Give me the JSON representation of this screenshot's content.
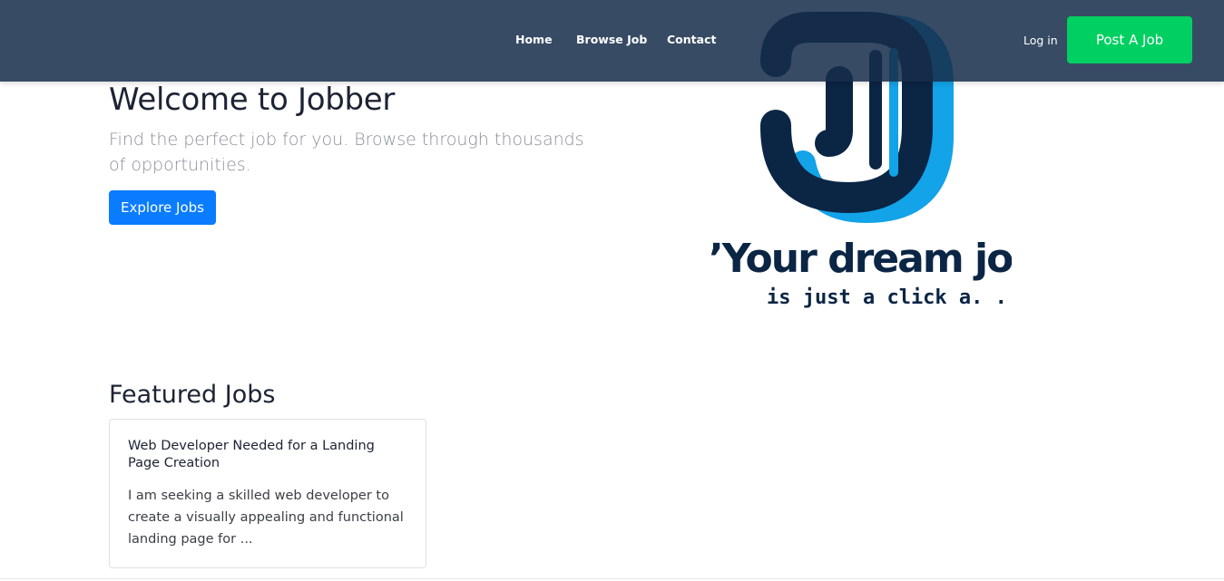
{
  "nav": {
    "home": "Home",
    "browse": "Browse Job",
    "contact": "Contact",
    "login": "Log in",
    "post_job": "Post A Job"
  },
  "hero": {
    "title": "Welcome to Jobber",
    "subtitle": "Find the perfect job for you. Browse through thousands of opportunities.",
    "cta": "Explore Jobs"
  },
  "logo": {
    "line1": "’Your dream job",
    "line2": "is just a click a. .",
    "colors": {
      "dark": "#0b2545",
      "light": "#12a3e8"
    }
  },
  "featured": {
    "heading": "Featured Jobs",
    "jobs": [
      {
        "title": "Web Developer Needed for a Landing Page Creation",
        "description": "I am seeking a skilled web developer to create a visually appealing and functional landing page for ..."
      }
    ]
  },
  "colors": {
    "navbar": "#2e4663",
    "primary": "#0a7cff",
    "success": "#00d062"
  }
}
